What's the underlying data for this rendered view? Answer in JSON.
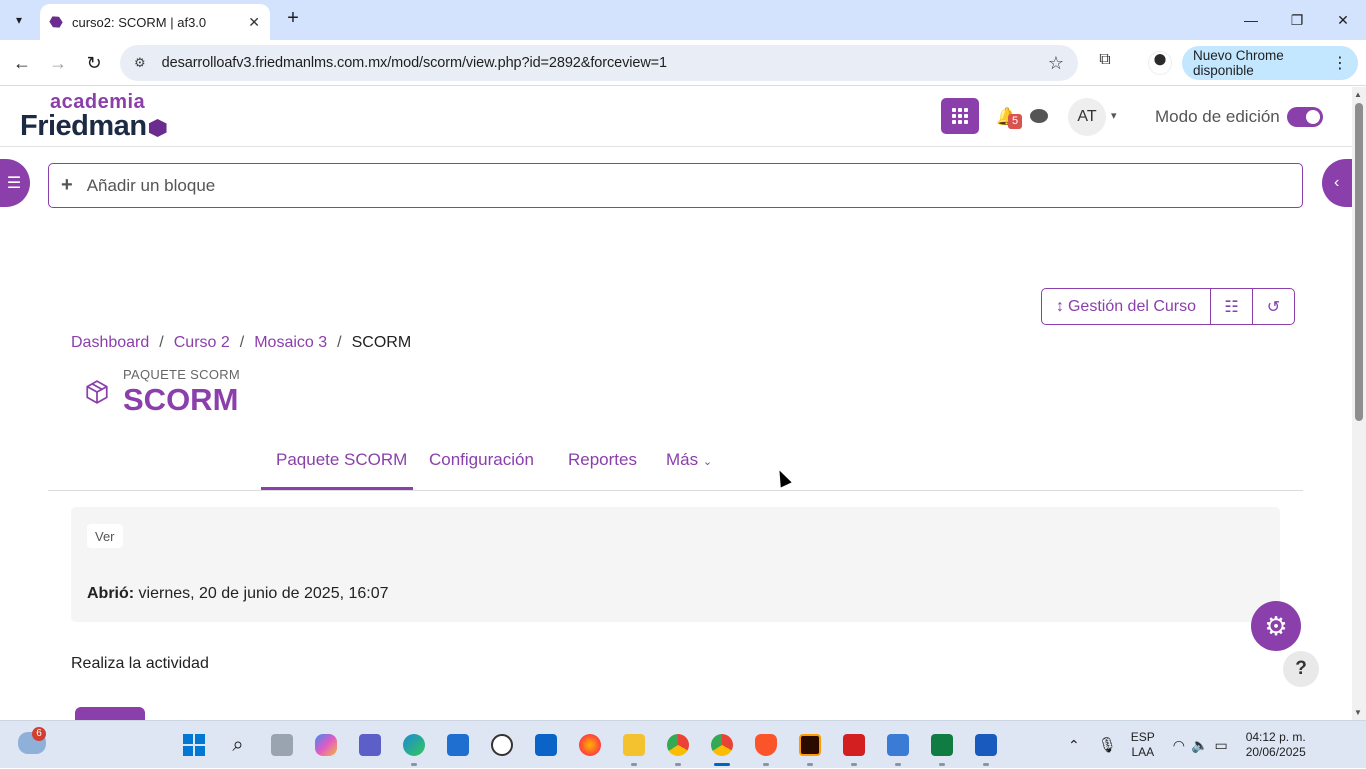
{
  "browser": {
    "tab_title": "curso2: SCORM | af3.0",
    "url": "desarrolloafv3.friedmanlms.com.mx/mod/scorm/view.php?id=2892&forceview=1",
    "update_label": "Nuevo Chrome disponible"
  },
  "header": {
    "logo_top": "academia",
    "logo_main": "Friedman",
    "notification_count": "5",
    "user_initials": "AT",
    "edit_mode_label": "Modo de edición",
    "edit_mode_on": true
  },
  "add_block_label": "Añadir un bloque",
  "course_management_label": "Gestión del Curso",
  "breadcrumb": {
    "items": [
      "Dashboard",
      "Curso 2",
      "Mosaico 3"
    ],
    "current": "SCORM"
  },
  "module": {
    "type_label": "PAQUETE SCORM",
    "title": "SCORM"
  },
  "tabs": [
    "Paquete SCORM",
    "Configuración",
    "Reportes",
    "Más"
  ],
  "info": {
    "badge": "Ver",
    "opened_label": "Abrió:",
    "opened_value": " viernes, 20 de junio de 2025, 16:07"
  },
  "activity_text": "Realiza la actividad",
  "taskbar": {
    "weather_badge": "6",
    "lang_top": "ESP",
    "lang_bottom": "LAA",
    "time": "04:12 p. m.",
    "date": "20/06/2025"
  },
  "colors": {
    "accent": "#8b3fab",
    "tab_strip": "#d3e3fd"
  }
}
